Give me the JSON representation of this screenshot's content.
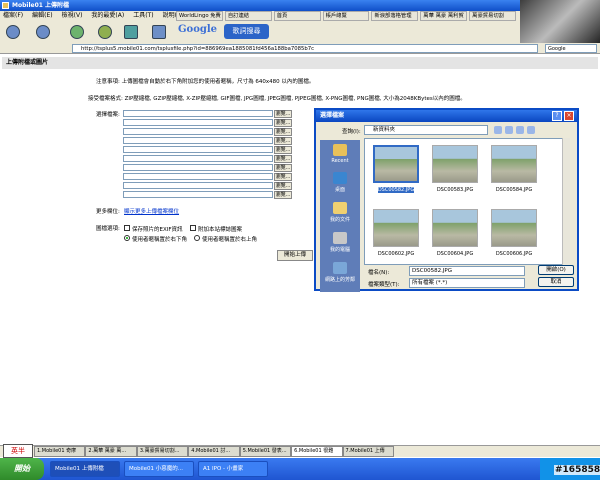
{
  "window": {
    "title": "Mobile01 上傳附檔"
  },
  "menu": [
    "檔案(F)",
    "編輯(E)",
    "檢視(V)",
    "我的最愛(A)",
    "工具(T)",
    "說明(H)"
  ],
  "tabs": [
    "WorldLingo 免費",
    "自訂連結",
    "首頁",
    "帳戶總覽",
    "新浪部落格管理",
    "萬華 萬豪 萬利賀",
    "萬豪貿易切割"
  ],
  "toolbar": {
    "google": "Google",
    "search_logo": "歌詞搜尋"
  },
  "address": {
    "url": "http://tsplus5.mobile01.com/tsplusfile.php?id=886969ea1885081fd456a188ba7085b7c"
  },
  "google_box": {
    "label": "Google"
  },
  "page": {
    "header": "上傳附檔或圖片",
    "note": "注意事項: 上傳圖檔會自動於右下角附加您的使用者暱稱，尺寸為 640x480 以內的圖檔。",
    "formats": "接受檔案格式: ZIP壓縮檔, GZIP壓縮檔, X-ZIP壓縮檔, GIF圖檔, JPG圖檔, JPEG圖檔, PJPEG圖檔, X-PNG圖檔, PNG圖檔, 大小為2048KBytes以內的圖檔。",
    "choose_label": "選擇檔案:",
    "browse": "瀏覽...",
    "more_label": "更多欄位:",
    "more_link": "顯示更多上傳檔案欄位",
    "opts_label": "圖檔選項:",
    "opt_exif": "保存照片的EXIF資訊",
    "opt_watermark": "附加本站標誌圖案",
    "opt_name_br": "使用者暱稱置於右下角",
    "opt_name_tr": "使用者暱稱置於右上角",
    "upload": "開始上傳"
  },
  "dialog": {
    "title": "選擇檔案",
    "lookin_label": "查詢(I):",
    "lookin_value": "新資料夾",
    "places": [
      "Recent",
      "桌面",
      "我的文件",
      "我的電腦",
      "網路上的芳鄰"
    ],
    "files": [
      "DSC00582.JPG",
      "DSC00583.JPG",
      "DSC00584.JPG",
      "DSC00602.JPG",
      "DSC00604.JPG",
      "DSC00606.JPG"
    ],
    "fname_label": "檔名(N):",
    "fname_value": "DSC00582.JPG",
    "ftype_label": "檔案類型(T):",
    "ftype_value": "所有檔案 (*.*)",
    "open": "開啟(O)",
    "cancel": "取消"
  },
  "wintabs": [
    "1.Mobile01 奇摩",
    "2.萬華 萬豪 萬...",
    "3.萬豪貿易切割...",
    "4.Mobile01 討...",
    "5.Mobile01 發表...",
    "6.Mobile01 很難",
    "7.Mobile01 上傳"
  ],
  "ime": "英半",
  "taskbar": {
    "start": "開始",
    "tasks": [
      "Mobile01 上傳附檔",
      "Mobile01 小惡魔的...",
      "A1 IPO - 小畫家"
    ]
  },
  "watermark": "#165858"
}
